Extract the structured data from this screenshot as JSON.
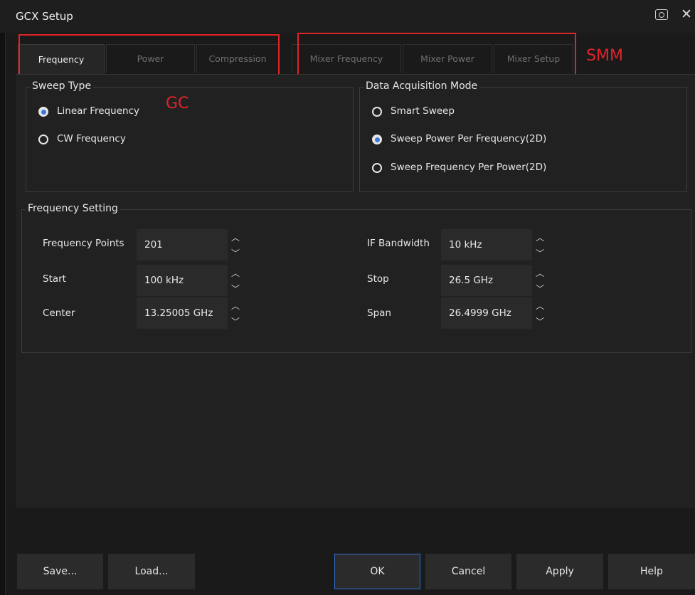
{
  "window": {
    "title": "GCX Setup"
  },
  "tabs": [
    {
      "label": "Frequency",
      "active": true
    },
    {
      "label": "Power",
      "active": false
    },
    {
      "label": "Compression",
      "active": false
    },
    {
      "label": "Mixer Frequency",
      "active": false
    },
    {
      "label": "Mixer Power",
      "active": false
    },
    {
      "label": "Mixer Setup",
      "active": false
    }
  ],
  "annotations": {
    "gc": "GC",
    "smm": "SMM",
    "color": "#e0242a"
  },
  "sweep_type": {
    "label": "Sweep Type",
    "options": [
      {
        "label": "Linear Frequency",
        "selected": true
      },
      {
        "label": "CW Frequency",
        "selected": false
      }
    ]
  },
  "acquisition": {
    "label": "Data Acquisition Mode",
    "options": [
      {
        "label": "Smart Sweep",
        "selected": false
      },
      {
        "label": "Sweep Power Per Frequency(2D)",
        "selected": true
      },
      {
        "label": "Sweep Frequency Per Power(2D)",
        "selected": false
      }
    ]
  },
  "frequency_setting": {
    "label": "Frequency Setting",
    "left": [
      {
        "label": "Frequency Points",
        "value": "201"
      },
      {
        "label": "Start",
        "value": "100 kHz"
      },
      {
        "label": "Center",
        "value": "13.25005 GHz"
      }
    ],
    "right": [
      {
        "label": "IF Bandwidth",
        "value": "10 kHz"
      },
      {
        "label": "Stop",
        "value": "26.5 GHz"
      },
      {
        "label": "Span",
        "value": "26.4999 GHz"
      }
    ]
  },
  "buttons": {
    "save": "Save...",
    "load": "Load...",
    "ok": "OK",
    "cancel": "Cancel",
    "apply": "Apply",
    "help": "Help"
  },
  "colors": {
    "accent": "#3b78d8",
    "background": "#1a1a1a",
    "panel": "#212121"
  },
  "icons": {
    "camera": "camera-icon",
    "close": "close-icon"
  }
}
